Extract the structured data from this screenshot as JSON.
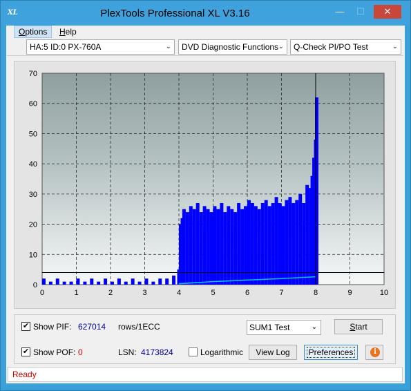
{
  "window": {
    "title": "PlexTools Professional XL V3.16",
    "icon_text": "XL",
    "icon": "plextools-icon"
  },
  "title_buttons": {
    "minimize": "—",
    "maximize": "☐",
    "close": "✕"
  },
  "menu": [
    {
      "label": "Options",
      "accel": "O",
      "rest": "ptions"
    },
    {
      "label": "Help",
      "accel": "H",
      "rest": "elp"
    }
  ],
  "toolbar": {
    "drive": "HA:5 ID:0  PX-760A",
    "function": "DVD Diagnostic Functions",
    "test": "Q-Check PI/PO Test"
  },
  "chart_data": {
    "type": "bar",
    "xlim": [
      0,
      10
    ],
    "ylim": [
      0,
      70
    ],
    "x_ticks": [
      "0",
      "1",
      "2",
      "3",
      "4",
      "5",
      "6",
      "7",
      "8",
      "9",
      "10"
    ],
    "y_ticks": [
      "0",
      "10",
      "20",
      "30",
      "40",
      "50",
      "60",
      "70"
    ],
    "grid": true,
    "threshold_line": 4,
    "data_end_x": 8,
    "series": [
      {
        "kind": "bars",
        "color": "#0000ff",
        "x": [
          0.0,
          0.2,
          0.4,
          0.6,
          0.8,
          1.0,
          1.2,
          1.4,
          1.6,
          1.8,
          2.0,
          2.2,
          2.4,
          2.6,
          2.8,
          3.0,
          3.2,
          3.4,
          3.6,
          3.8,
          3.95,
          4.0,
          4.05,
          4.1,
          4.2,
          4.3,
          4.4,
          4.5,
          4.6,
          4.7,
          4.8,
          4.9,
          5.0,
          5.1,
          5.2,
          5.3,
          5.4,
          5.5,
          5.6,
          5.7,
          5.8,
          5.9,
          6.0,
          6.1,
          6.2,
          6.3,
          6.4,
          6.5,
          6.6,
          6.7,
          6.8,
          6.9,
          7.0,
          7.1,
          7.2,
          7.3,
          7.4,
          7.5,
          7.6,
          7.7,
          7.8,
          7.85,
          7.9,
          7.95,
          7.98
        ],
        "values": [
          2,
          1,
          2,
          1,
          1,
          2,
          1,
          2,
          1,
          2,
          1,
          2,
          1,
          2,
          1,
          2,
          1,
          2,
          2,
          3,
          5,
          20,
          22,
          25,
          24,
          26,
          25,
          27,
          24,
          26,
          25,
          24,
          26,
          25,
          27,
          24,
          26,
          25,
          24,
          27,
          25,
          26,
          28,
          27,
          26,
          25,
          27,
          28,
          26,
          27,
          29,
          27,
          26,
          28,
          29,
          27,
          28,
          30,
          27,
          33,
          32,
          36,
          42,
          48,
          62
        ]
      },
      {
        "kind": "line",
        "color": "#00c8d8",
        "x": [
          4.0,
          5.0,
          6.0,
          7.0,
          8.0
        ],
        "values": [
          0.3,
          1.0,
          1.5,
          2.0,
          2.6
        ]
      }
    ]
  },
  "bottom": {
    "show_pif_label": "Show PIF:",
    "show_pif_checked": "✔",
    "pif_value": "627014",
    "pif_unit": "rows/1ECC",
    "show_pof_label": "Show POF:",
    "show_pof_checked": "✔",
    "pof_value": "0",
    "lsn_label": "LSN:",
    "lsn_value": "4173824",
    "log_label": "Logarithmic",
    "sum_select": "SUM1 Test",
    "start_btn": "Start",
    "start_accel": "S",
    "start_rest": "tart",
    "viewlog_btn": "View Log",
    "pref_btn": "Preferences",
    "info_btn": "i"
  },
  "status": {
    "text": "Ready"
  }
}
